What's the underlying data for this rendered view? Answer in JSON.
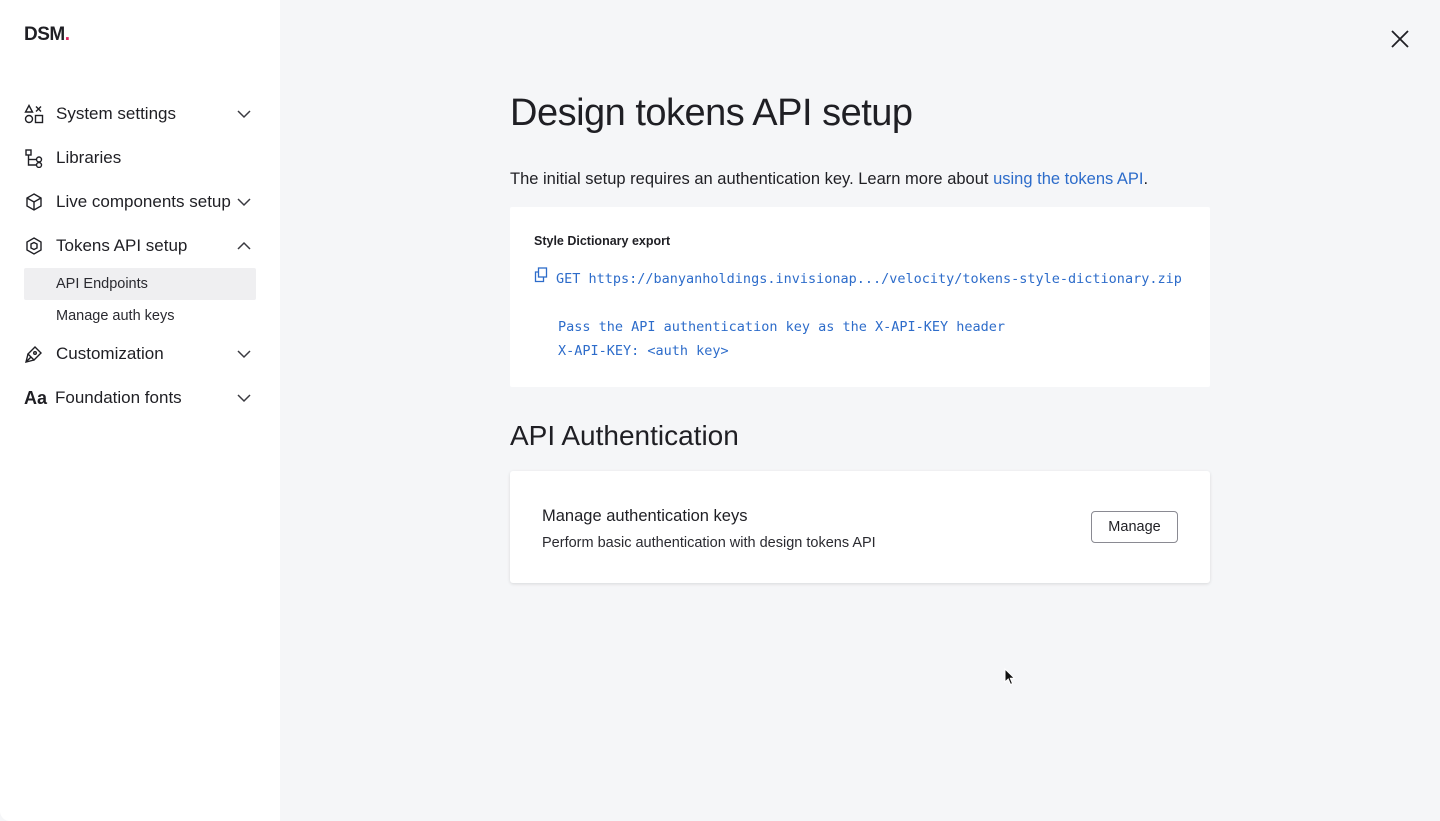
{
  "logo": {
    "text": "DSM",
    "dot": "."
  },
  "sidebar": {
    "items": [
      {
        "label": "System settings",
        "icon": "system-settings-icon",
        "chevron": "down"
      },
      {
        "label": "Libraries",
        "icon": "libraries-icon"
      },
      {
        "label": "Live components setup",
        "icon": "cube-icon",
        "chevron": "down"
      },
      {
        "label": "Tokens API setup",
        "icon": "tokens-icon",
        "chevron": "up"
      },
      {
        "label": "Customization",
        "icon": "brush-icon",
        "chevron": "down"
      },
      {
        "label": "Foundation fonts",
        "icon": "font-icon",
        "icon_text": "Aa",
        "chevron": "down"
      }
    ],
    "subitems": [
      {
        "label": "API Endpoints",
        "active": true
      },
      {
        "label": "Manage auth keys",
        "active": false
      }
    ]
  },
  "main": {
    "title": "Design tokens API setup",
    "intro_text": "The initial setup requires an authentication key. Learn more about ",
    "intro_link": "using the tokens API",
    "intro_end": ".",
    "export": {
      "title": "Style Dictionary export",
      "get_line": "GET https://banyanholdings.invisionap.../velocity/tokens-style-dictionary.zip",
      "line2": "Pass the API authentication key as the X-API-KEY header",
      "line3": "X-API-KEY: <auth key>"
    },
    "auth_section_title": "API Authentication",
    "auth_card": {
      "heading": "Manage authentication keys",
      "description": "Perform basic authentication with design tokens API",
      "button": "Manage"
    }
  },
  "colors": {
    "accent": "#2d6cca",
    "logo_dot": "#e0245e",
    "page_bg": "#f5f6f8"
  }
}
